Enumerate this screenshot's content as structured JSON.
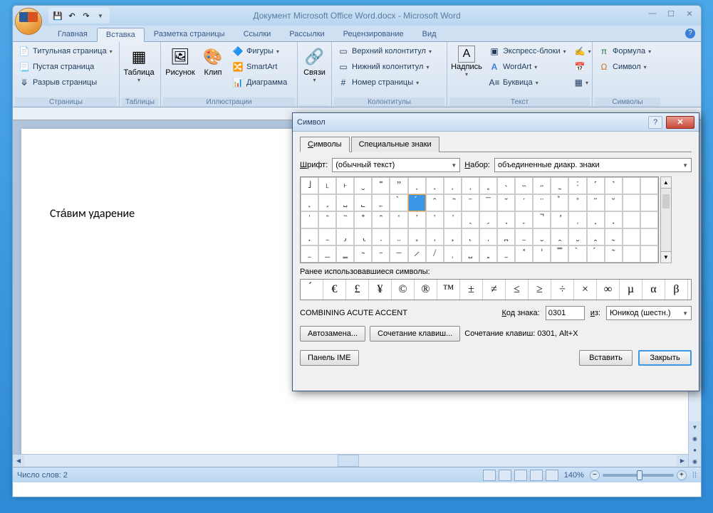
{
  "app": {
    "title": "Документ Microsoft Office Word.docx - Microsoft Word"
  },
  "tabs": {
    "home": "Главная",
    "insert": "Вставка",
    "layout": "Разметка страницы",
    "refs": "Ссылки",
    "mail": "Рассылки",
    "review": "Рецензирование",
    "view": "Вид"
  },
  "ribbon": {
    "pages": {
      "label": "Страницы",
      "cover": "Титульная страница",
      "blank": "Пустая страница",
      "break": "Разрыв страницы"
    },
    "tables": {
      "label": "Таблицы",
      "btn": "Таблица"
    },
    "illus": {
      "label": "Иллюстрации",
      "pic": "Рисунок",
      "clip": "Клип",
      "shapes": "Фигуры",
      "smartart": "SmartArt",
      "chart": "Диаграмма"
    },
    "links": {
      "label": "Связи",
      "btn": "Связи"
    },
    "header": {
      "label": "Колонтитулы",
      "top": "Верхний колонтитул",
      "bottom": "Нижний колонтитул",
      "page": "Номер страницы"
    },
    "text": {
      "label": "Текст",
      "textbox": "Надпись",
      "quick": "Экспресс-блоки",
      "wordart": "WordArt",
      "dropcap": "Буквица"
    },
    "symbols": {
      "label": "Символы",
      "formula": "Формула",
      "symbol": "Символ"
    }
  },
  "document": {
    "text": "Ста́вим ударение"
  },
  "statusbar": {
    "words": "Число слов: 2",
    "zoom": "140%"
  },
  "dialog": {
    "title": "Символ",
    "tab_symbols": "Символы",
    "tab_special": "Специальные знаки",
    "font_label": "Шрифт:",
    "font_value": "(обычный текст)",
    "set_label": "Набор:",
    "set_value": "объединенные диакр. знаки",
    "grid": [
      [
        "˩",
        "˪",
        "˫",
        "ˬ",
        "˭",
        "ˮ",
        "˯",
        "˰",
        "˱",
        "˲",
        "˳",
        "˴",
        "˵",
        "˶",
        "˷",
        "˸",
        "˹",
        "˺",
        " ",
        " "
      ],
      [
        "˻",
        "˼",
        "˽",
        "˾",
        "˿",
        "̀",
        "́",
        "̂",
        "̃",
        "̄",
        "̅",
        "̆",
        "̇",
        "̈",
        "̉",
        "̊",
        "̋",
        "̌",
        " ",
        " "
      ],
      [
        "̍",
        "̎",
        "̏",
        "̐",
        "̑",
        "̒",
        "̓",
        "̔",
        "̕",
        "̖",
        "̗",
        "̘",
        "̙",
        "̚",
        "̛",
        "̜",
        "̝",
        "̞",
        " ",
        " "
      ],
      [
        "̟",
        "̠",
        "̡",
        "̢",
        "̣",
        "̤",
        "̥",
        "̦",
        "̧",
        "̨",
        "̩",
        "̪",
        "̫",
        "̬",
        "̭",
        "̮",
        "̯",
        "̰",
        " ",
        " "
      ],
      [
        "̱",
        "̲",
        "̳",
        "̴",
        "̵",
        "̶",
        "̷",
        "̸",
        "̹",
        "̺",
        "̻",
        "̼",
        "̽",
        "̾",
        "̿",
        "̀",
        "́",
        "͂",
        " ",
        " "
      ]
    ],
    "selected_row": 1,
    "selected_col": 6,
    "recent_label": "Ранее использовавшиеся символы:",
    "recent": [
      "́",
      "€",
      "£",
      "¥",
      "©",
      "®",
      "™",
      "±",
      "≠",
      "≤",
      "≥",
      "÷",
      "×",
      "∞",
      "µ",
      "α",
      "β"
    ],
    "char_name": "COMBINING ACUTE ACCENT",
    "code_label": "Код знака:",
    "code_value": "0301",
    "from_label": "из:",
    "from_value": "Юникод (шестн.)",
    "autoreplace": "Автозамена...",
    "shortcut_btn": "Сочетание клавиш...",
    "shortcut_text": "Сочетание клавиш: 0301, Alt+X",
    "ime": "Панель IME",
    "insert": "Вставить",
    "close": "Закрыть"
  }
}
